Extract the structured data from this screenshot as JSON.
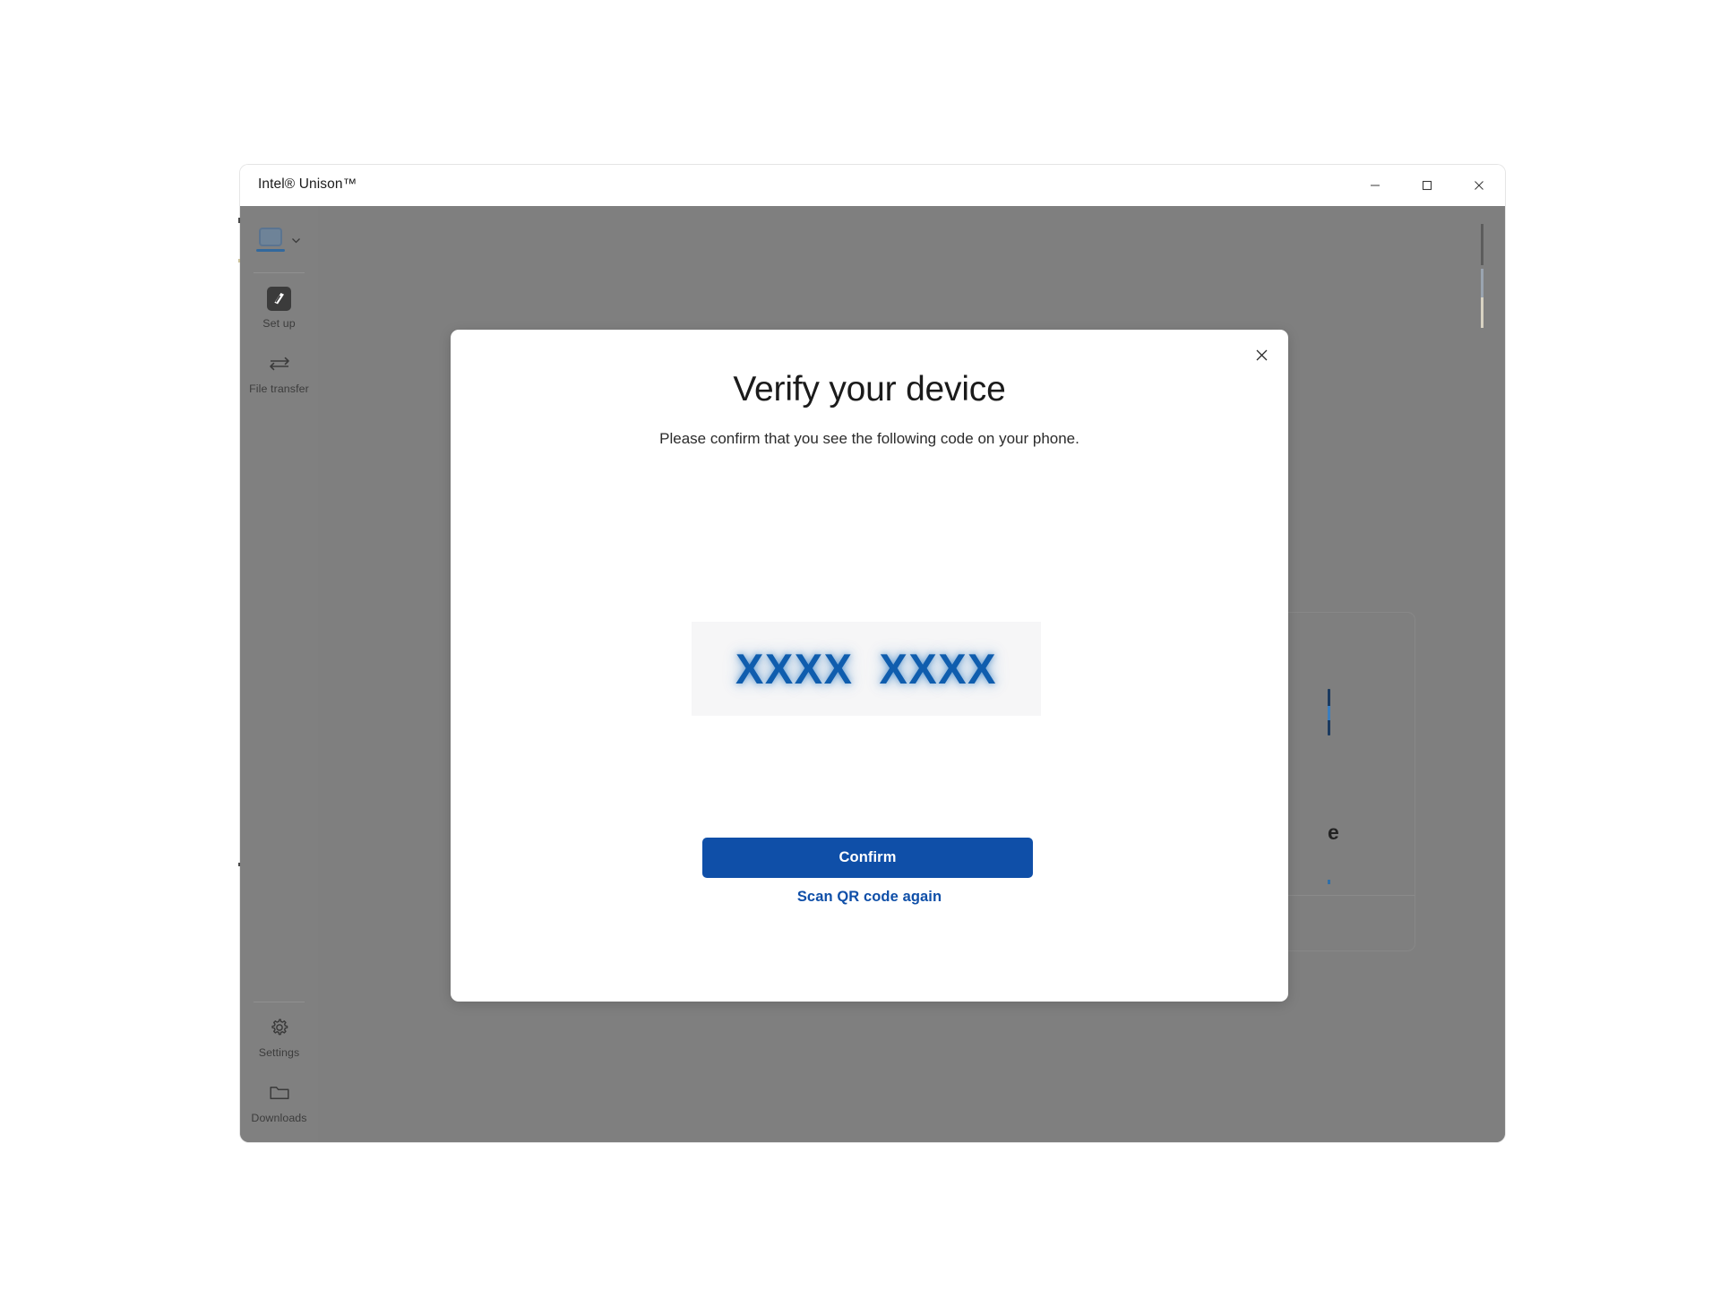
{
  "window": {
    "title": "Intel® Unison™",
    "controls": {
      "minimize": "minimize-button",
      "maximize": "maximize-button",
      "close": "close-button"
    }
  },
  "sidebar": {
    "device_selector": {
      "icon": "laptop-icon",
      "chevron": "chevron-down-icon"
    },
    "items_top": [
      {
        "label": "Set up",
        "icon": "setup-icon"
      },
      {
        "label": "File transfer",
        "icon": "file-transfer-icon"
      }
    ],
    "items_bottom": [
      {
        "label": "Settings",
        "icon": "gear-icon"
      },
      {
        "label": "Downloads",
        "icon": "folder-icon"
      }
    ]
  },
  "background": {
    "card_text_fragment": "e"
  },
  "modal": {
    "close_icon": "close-icon",
    "title": "Verify your device",
    "subtitle": "Please confirm that you see the following code on your phone.",
    "code": "XXXX  XXXX",
    "confirm_label": "Confirm",
    "secondary_link": "Scan QR code again"
  },
  "colors": {
    "accent": "#0f4fa8",
    "code_blue": "#0f5dae",
    "overlay_gray": "#7f7f7f",
    "sidebar_gray": "#808080",
    "code_box_bg": "#f6f6f7"
  }
}
